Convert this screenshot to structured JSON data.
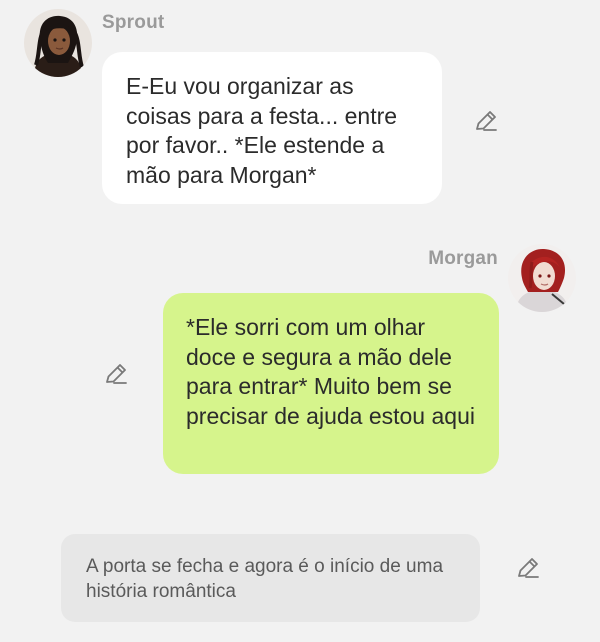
{
  "messages": [
    {
      "sender": "Sprout",
      "avatar_icon": "sprout-avatar",
      "text": "E-Eu vou organizar as coisas para a festa... entre por favor.. *Ele estende a mão para Morgan*",
      "edit_icon": "pencil-icon"
    },
    {
      "sender": "Morgan",
      "avatar_icon": "morgan-avatar",
      "text": "*Ele sorri com um olhar doce e segura a mão dele para entrar* Muito bem se precisar de ajuda estou aqui",
      "edit_icon": "pencil-icon"
    },
    {
      "sender": "",
      "text": "A porta se fecha e agora é o início de uma história romântica",
      "edit_icon": "pencil-icon"
    }
  ],
  "colors": {
    "background": "#f2f2f2",
    "incoming_bubble": "#ffffff",
    "outgoing_bubble": "#d6f48c",
    "narration_bubble": "#e7e7e7",
    "name_text": "#9a9a9a"
  }
}
